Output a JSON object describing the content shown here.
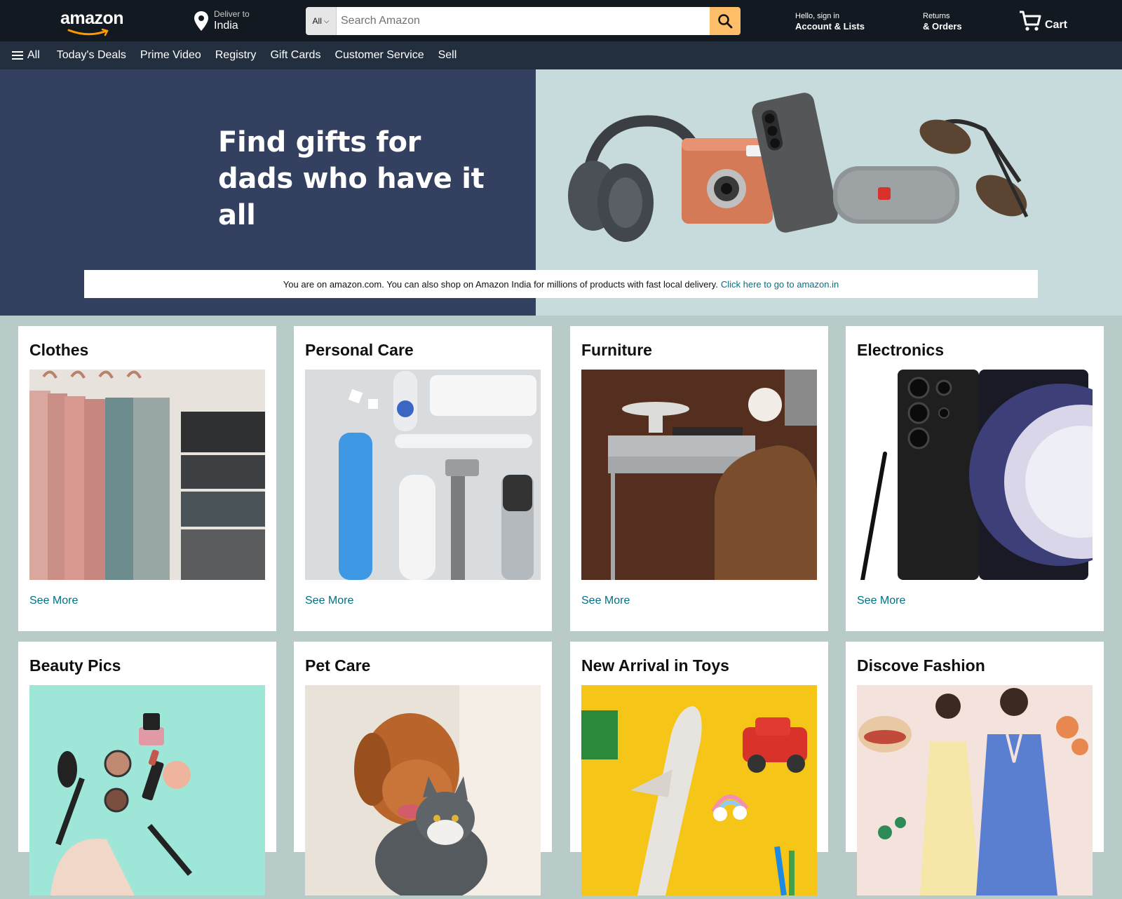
{
  "header": {
    "logo_text": "amazon",
    "deliver_label": "Deliver to",
    "deliver_location": "India",
    "search_category": "All",
    "search_placeholder": "Search Amazon",
    "account_greeting": "Hello, sign in",
    "account_label": "Account & Lists",
    "returns_label": "Returns",
    "orders_label": "& Orders",
    "cart_label": "Cart",
    "accent_color": "#febd69",
    "icons": [
      "location-pin-icon",
      "chevron-down-icon",
      "search-icon",
      "cart-icon"
    ]
  },
  "nav": {
    "all_label": "All",
    "links": [
      "Today's Deals",
      "Prime Video",
      "Registry",
      "Gift Cards",
      "Customer Service",
      "Sell"
    ]
  },
  "hero": {
    "title_line1": "Find gifts for",
    "title_line2": "dads who have it all",
    "notice_text": "You are on amazon.com. You can also shop on Amazon India for millions of products with fast local delivery.",
    "notice_link": "Click here to go to amazon.in"
  },
  "cards": [
    {
      "title": "Clothes",
      "link": "See More"
    },
    {
      "title": "Personal Care",
      "link": "See More"
    },
    {
      "title": "Furniture",
      "link": "See More"
    },
    {
      "title": "Electronics",
      "link": "See More"
    },
    {
      "title": "Beauty Pics",
      "link": ""
    },
    {
      "title": "Pet Care",
      "link": ""
    },
    {
      "title": "New Arrival in Toys",
      "link": ""
    },
    {
      "title": "Discove Fashion",
      "link": ""
    }
  ]
}
